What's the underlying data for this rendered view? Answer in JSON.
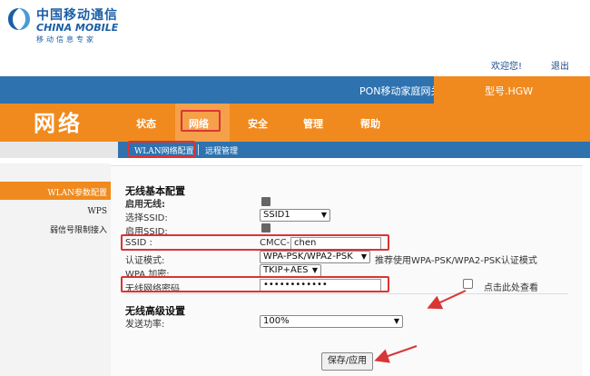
{
  "header": {
    "logo_cn": "中国移动通信",
    "logo_en": "CHINA MOBILE",
    "logo_slogan": "移动信息专家",
    "welcome": "欢迎您!",
    "logout": "退出",
    "product_name": "PON移动家庭网关",
    "model": "型号.HGW",
    "brand_title": "网络"
  },
  "nav": {
    "items": [
      "状态",
      "网络",
      "安全",
      "管理",
      "帮助"
    ],
    "active": "网络"
  },
  "subtabs": [
    "WLAN网络配置",
    "远程管理"
  ],
  "sidebar": {
    "items": [
      "WLAN参数配置",
      "WPS",
      "弱信号限制接入"
    ]
  },
  "form": {
    "basic_title": "无线基本配置",
    "enable_wireless_label": "启用无线:",
    "choose_ssid_label": "选择SSID:",
    "choose_ssid_value": "SSID1",
    "enable_ssid_label": "启用SSID:",
    "ssid_label": "SSID :",
    "ssid_prefix": "CMCC-",
    "ssid_value": "chen",
    "auth_label": "认证模式:",
    "auth_value": "WPA-PSK/WPA2-PSK",
    "auth_hint": "推荐使用WPA-PSK/WPA2-PSK认证模式",
    "wpa_label": "WPA 加密:",
    "wpa_value": "TKIP+AES",
    "password_label": "无线网络密码",
    "password_value": "••••••••••••",
    "show_password_label": "点击此处查看",
    "advanced_title": "无线高级设置",
    "power_label": "发送功率:",
    "power_value": "100%",
    "apply_label": "保存/应用"
  },
  "colors": {
    "orange": "#f08a1e",
    "blue": "#2e72b0",
    "annotation_red": "#d93535"
  }
}
